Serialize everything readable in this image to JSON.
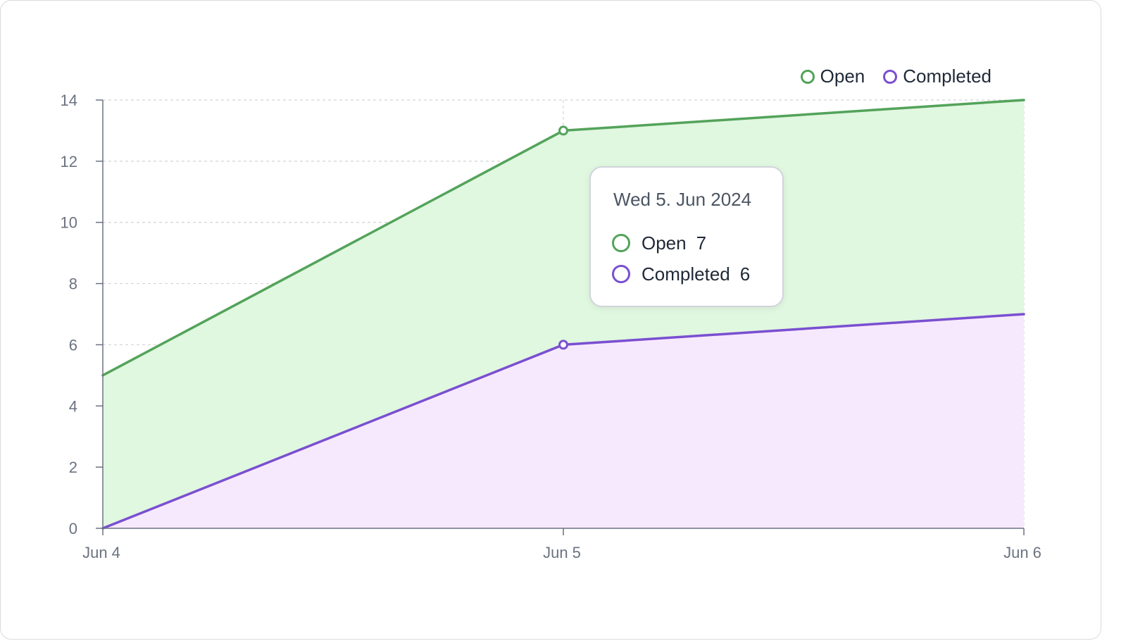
{
  "chart_data": {
    "type": "area",
    "stacked": true,
    "categories": [
      "Jun 4",
      "Jun 5",
      "Jun 6"
    ],
    "series": [
      {
        "name": "Completed",
        "values": [
          0,
          6,
          7
        ],
        "color": "#7a4fd1",
        "fill": "#f7e9fd"
      },
      {
        "name": "Open",
        "values": [
          5,
          7,
          7
        ],
        "color": "#53a35a",
        "fill": "#e0f7e0"
      }
    ],
    "ylim": [
      0,
      14
    ],
    "yticks": [
      0,
      2,
      4,
      6,
      8,
      10,
      12,
      14
    ],
    "grid": true,
    "legend_position": "top-right",
    "markers_at": "Jun 5"
  },
  "legend": [
    {
      "label": "Open",
      "color": "#53a35a"
    },
    {
      "label": "Completed",
      "color": "#7a4fd1"
    }
  ],
  "tooltip": {
    "title": "Wed 5. Jun 2024",
    "rows": [
      {
        "label": "Open",
        "value": "7",
        "color": "#53a35a"
      },
      {
        "label": "Completed",
        "value": "6",
        "color": "#7a4fd1"
      }
    ]
  }
}
